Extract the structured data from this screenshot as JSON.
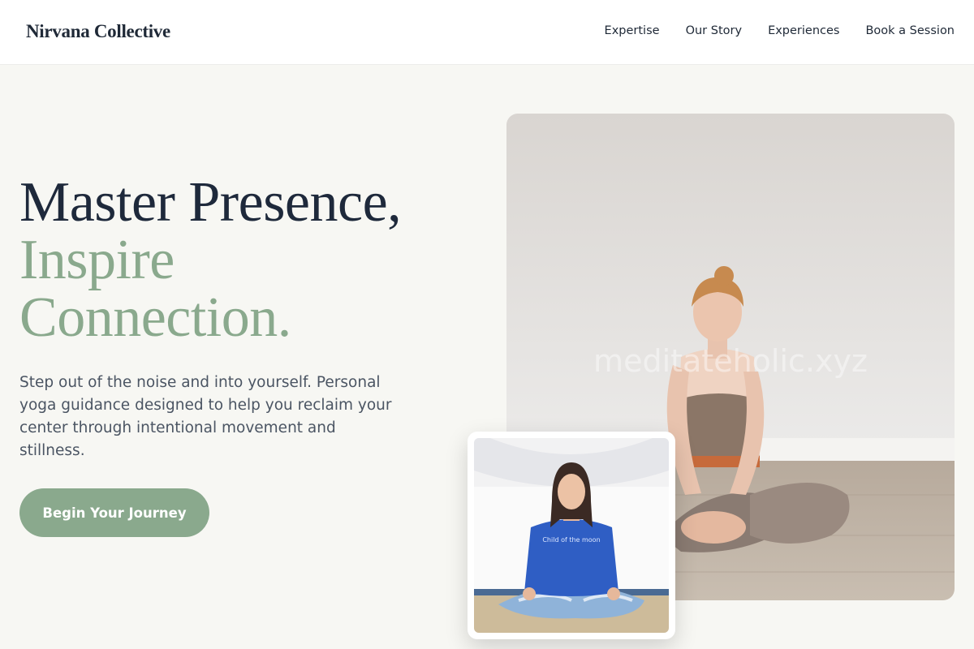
{
  "brand": {
    "name": "Nirvana Collective"
  },
  "nav": {
    "items": [
      {
        "label": "Expertise"
      },
      {
        "label": "Our Story"
      },
      {
        "label": "Experiences"
      },
      {
        "label": "Book a Session"
      }
    ]
  },
  "hero": {
    "headline_line1": "Master Presence,",
    "headline_line2": "Inspire",
    "headline_line3": "Connection.",
    "subtext": "Step out of the noise and into yourself. Personal yoga guidance designed to help you reclaim your center through intentional movement and stillness.",
    "cta_label": "Begin Your Journey"
  },
  "images": {
    "main_photo": {
      "watermark": "meditateholic.xyz"
    },
    "inset_photo": {
      "sweatshirt_text": "Child of the moon"
    }
  },
  "colors": {
    "accent_sage": "#8aa98d",
    "heading_dark": "#1e293b",
    "background": "#f7f7f3"
  }
}
